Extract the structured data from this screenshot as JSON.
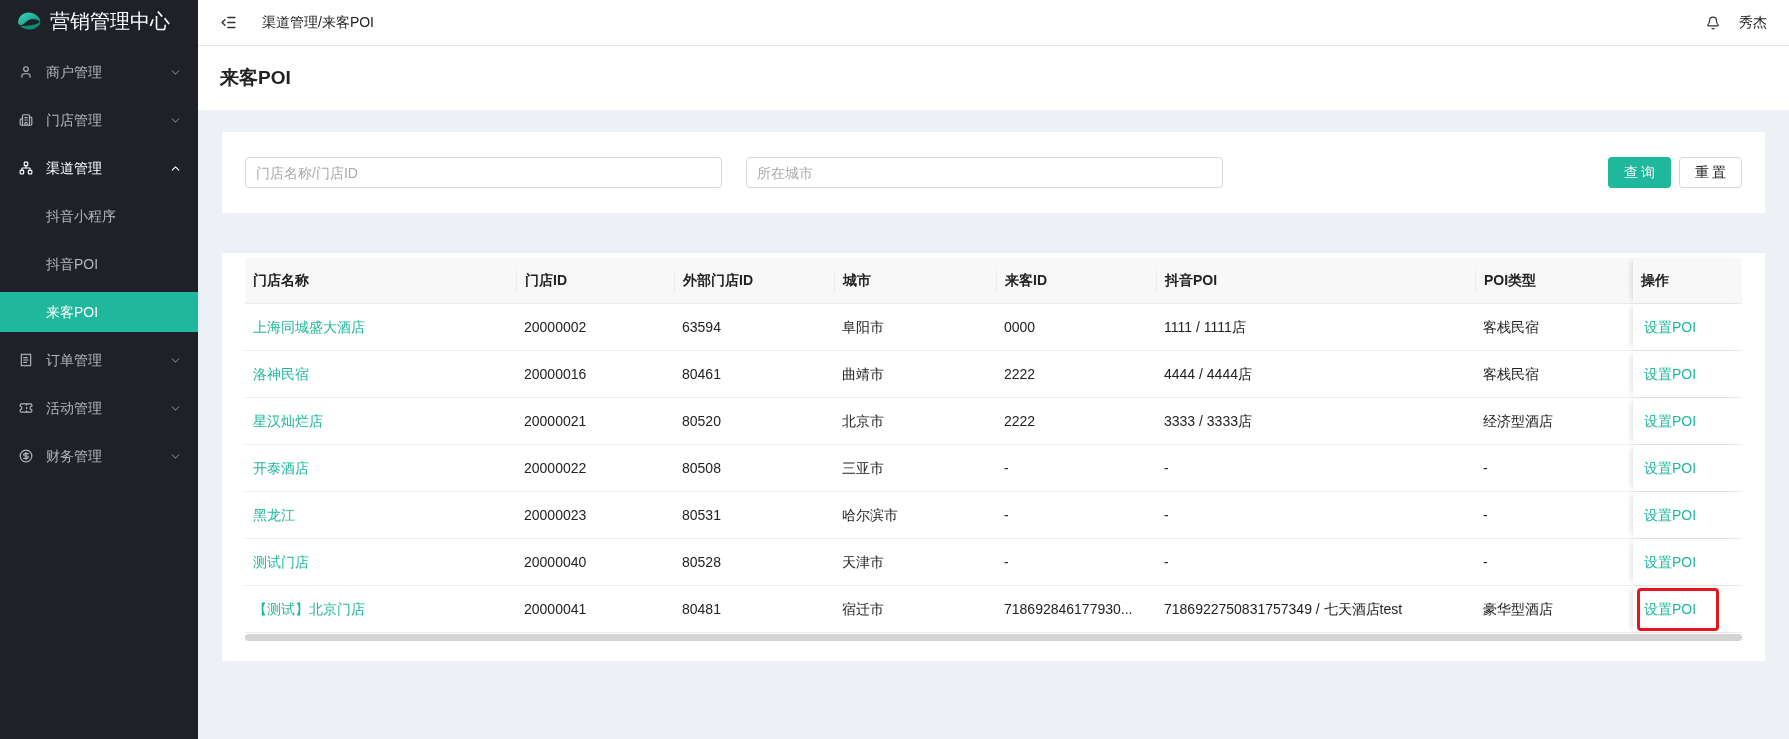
{
  "brand": {
    "title": "营销管理中心"
  },
  "sidebar": {
    "items": [
      {
        "label": "商户管理",
        "expanded": false
      },
      {
        "label": "门店管理",
        "expanded": false
      },
      {
        "label": "渠道管理",
        "expanded": true,
        "children": [
          {
            "label": "抖音小程序",
            "selected": false
          },
          {
            "label": "抖音POI",
            "selected": false
          },
          {
            "label": "来客POI",
            "selected": true
          }
        ]
      },
      {
        "label": "订单管理",
        "expanded": false
      },
      {
        "label": "活动管理",
        "expanded": false
      },
      {
        "label": "财务管理",
        "expanded": false
      }
    ]
  },
  "topbar": {
    "breadcrumb": "渠道管理/来客POI",
    "user": "秀杰"
  },
  "page_title": "来客POI",
  "filters": {
    "fields": [
      {
        "placeholder": "门店名称/门店ID"
      },
      {
        "placeholder": "所在城市"
      }
    ],
    "buttons": [
      {
        "label": "查 询",
        "kind": "primary"
      },
      {
        "label": "重 置",
        "kind": "default"
      }
    ]
  },
  "table": {
    "columns": [
      "门店名称",
      "门店ID",
      "外部门店ID",
      "城市",
      "来客ID",
      "抖音POI",
      "POI类型",
      "操作"
    ],
    "rows": [
      {
        "cells": [
          "上海同城盛大酒店",
          "20000002",
          "63594",
          "阜阳市",
          "0000",
          "1111 / 1111店",
          "客栈民宿"
        ],
        "action": "设置POI",
        "highlighted": false
      },
      {
        "cells": [
          "洛神民宿",
          "20000016",
          "80461",
          "曲靖市",
          "2222",
          "4444 / 4444店",
          "客栈民宿"
        ],
        "action": "设置POI",
        "highlighted": false
      },
      {
        "cells": [
          "星汉灿烂店",
          "20000021",
          "80520",
          "北京市",
          "2222",
          "3333 / 3333店",
          "经济型酒店"
        ],
        "action": "设置POI",
        "highlighted": false
      },
      {
        "cells": [
          "开泰酒店",
          "20000022",
          "80508",
          "三亚市",
          "-",
          "-",
          "-"
        ],
        "action": "设置POI",
        "highlighted": false
      },
      {
        "cells": [
          "黑龙江",
          "20000023",
          "80531",
          "哈尔滨市",
          "-",
          "-",
          "-"
        ],
        "action": "设置POI",
        "highlighted": false
      },
      {
        "cells": [
          "测试门店",
          "20000040",
          "80528",
          "天津市",
          "-",
          "-",
          "-"
        ],
        "action": "设置POI",
        "highlighted": false
      },
      {
        "cells": [
          "【测试】北京门店",
          "20000041",
          "80481",
          "宿迁市",
          "718692846177930...",
          "7186922750831757349 / 七天酒店test",
          "豪华型酒店"
        ],
        "action": "设置POI",
        "highlighted": true
      }
    ]
  }
}
